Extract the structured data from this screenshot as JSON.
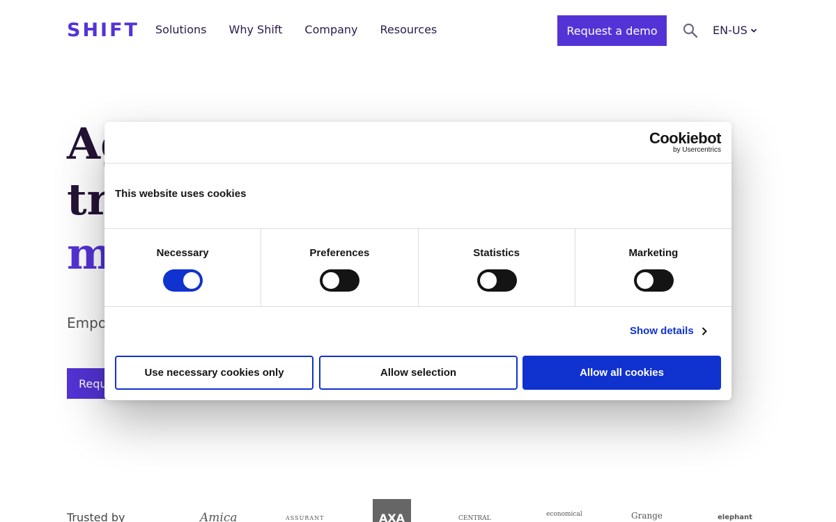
{
  "header": {
    "logo": "SHIFT",
    "nav": [
      "Solutions",
      "Why Shift",
      "Company",
      "Resources"
    ],
    "demo_button": "Request a demo",
    "search_icon": "search-icon",
    "language": "EN-US",
    "language_icon": "chevron-down-icon"
  },
  "hero": {
    "line1": "Ag",
    "line2": "tr",
    "line3": "m",
    "subtitle": "Empo",
    "button": "Requ"
  },
  "trusted": {
    "label": "Trusted by",
    "partners": [
      "Amica",
      "ASSURANT",
      "AXA",
      "CENTRAL",
      "economical",
      "Grange",
      "elephant"
    ]
  },
  "cookie_dialog": {
    "brand": "Cookiebot",
    "brand_sub": "by Usercentrics",
    "title": "This website uses cookies",
    "categories": [
      {
        "label": "Necessary",
        "enabled": true
      },
      {
        "label": "Preferences",
        "enabled": false
      },
      {
        "label": "Statistics",
        "enabled": false
      },
      {
        "label": "Marketing",
        "enabled": false
      }
    ],
    "show_details": "Show details",
    "buttons": {
      "necessary_only": "Use necessary cookies only",
      "allow_selection": "Allow selection",
      "allow_all": "Allow all cookies"
    },
    "colors": {
      "accent": "#1032cf",
      "brand": "#5433d6"
    }
  }
}
